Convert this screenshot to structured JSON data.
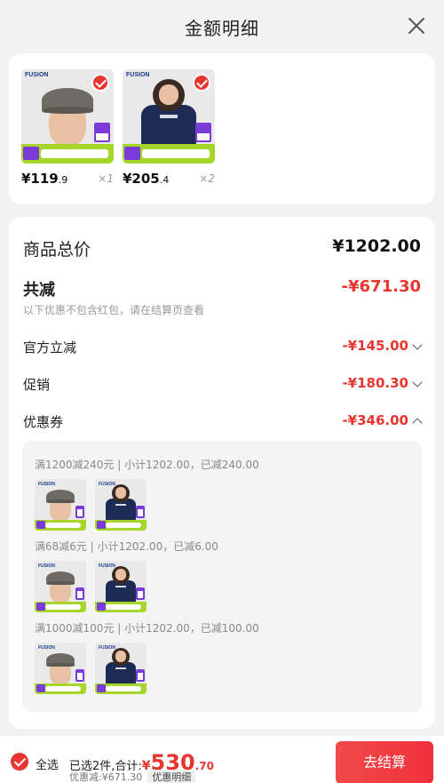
{
  "header": {
    "title": "金额明细"
  },
  "products": [
    {
      "brand": "FUSION",
      "price_main": "¥119",
      "price_dec": ".9",
      "qty": "×1",
      "kind": "hat"
    },
    {
      "brand": "FUSION",
      "price_main": "¥205",
      "price_dec": ".4",
      "qty": "×2",
      "kind": "tee"
    }
  ],
  "summary": {
    "total_label": "商品总价",
    "total_value": "¥1202.00",
    "reduce_label": "共减",
    "reduce_value": "-¥671.30",
    "reduce_note": "以下优惠不包含红包，请在结算页查看",
    "official_label": "官方立减",
    "official_value": "-¥145.00",
    "promo_label": "促销",
    "promo_value": "-¥180.30",
    "coupon_label": "优惠券",
    "coupon_value": "-¥346.00"
  },
  "coupons": [
    {
      "title": "满1200减240元 | 小计1202.00，已减240.00"
    },
    {
      "title": "满68减6元 | 小计1202.00，已减6.00"
    },
    {
      "title": "满1000减100元 | 小计1202.00，已减100.00"
    }
  ],
  "footer": {
    "select_all": "全选",
    "selected_text": "已选2件,合计:",
    "currency": "¥",
    "amount_main": "530",
    "amount_dec": ".70",
    "discount_text": "优惠减:¥671.30",
    "detail_link": "优惠明细",
    "checkout": "去结算"
  },
  "colors": {
    "accent": "#e8352f",
    "promo_green": "#a6d62a",
    "price_purple": "#7a3bd8"
  }
}
